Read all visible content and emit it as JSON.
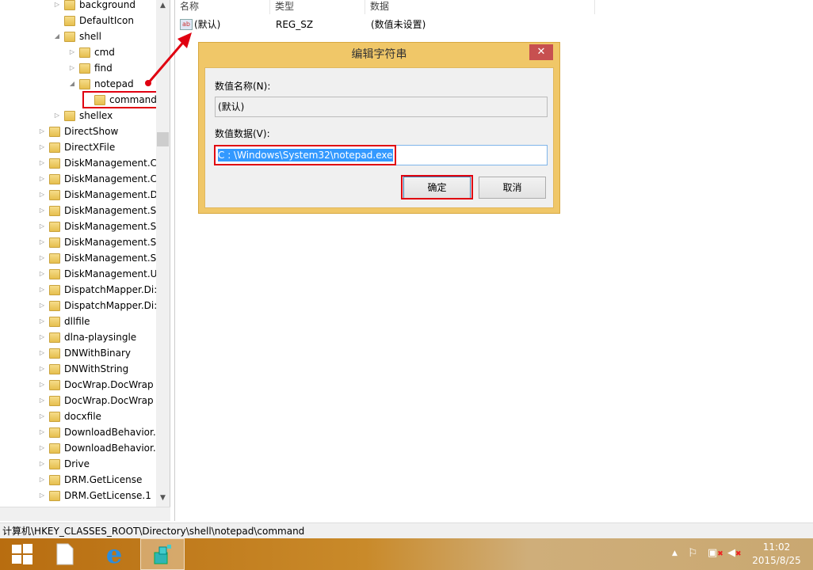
{
  "tree": {
    "items": [
      {
        "label": "background",
        "level": 2,
        "expander": "collapsed"
      },
      {
        "label": "DefaultIcon",
        "level": 2,
        "expander": "none"
      },
      {
        "label": "shell",
        "level": 2,
        "expander": "expanded"
      },
      {
        "label": "cmd",
        "level": 3,
        "expander": "collapsed"
      },
      {
        "label": "find",
        "level": 3,
        "expander": "collapsed"
      },
      {
        "label": "notepad",
        "level": 3,
        "expander": "expanded"
      },
      {
        "label": "command",
        "level": 4,
        "expander": "none",
        "selected": true
      },
      {
        "label": "shellex",
        "level": 2,
        "expander": "collapsed"
      },
      {
        "label": "DirectShow",
        "level": 1,
        "expander": "collapsed"
      },
      {
        "label": "DirectXFile",
        "level": 1,
        "expander": "collapsed"
      },
      {
        "label": "DiskManagement.C",
        "level": 1,
        "expander": "collapsed"
      },
      {
        "label": "DiskManagement.C",
        "level": 1,
        "expander": "collapsed"
      },
      {
        "label": "DiskManagement.D",
        "level": 1,
        "expander": "collapsed"
      },
      {
        "label": "DiskManagement.Sı",
        "level": 1,
        "expander": "collapsed"
      },
      {
        "label": "DiskManagement.Sı",
        "level": 1,
        "expander": "collapsed"
      },
      {
        "label": "DiskManagement.Sı",
        "level": 1,
        "expander": "collapsed"
      },
      {
        "label": "DiskManagement.Sı",
        "level": 1,
        "expander": "collapsed"
      },
      {
        "label": "DiskManagement.U",
        "level": 1,
        "expander": "collapsed"
      },
      {
        "label": "DispatchMapper.Di:",
        "level": 1,
        "expander": "collapsed"
      },
      {
        "label": "DispatchMapper.Di:",
        "level": 1,
        "expander": "collapsed"
      },
      {
        "label": "dllfile",
        "level": 1,
        "expander": "collapsed"
      },
      {
        "label": "dlna-playsingle",
        "level": 1,
        "expander": "collapsed"
      },
      {
        "label": "DNWithBinary",
        "level": 1,
        "expander": "collapsed"
      },
      {
        "label": "DNWithString",
        "level": 1,
        "expander": "collapsed"
      },
      {
        "label": "DocWrap.DocWrap",
        "level": 1,
        "expander": "collapsed"
      },
      {
        "label": "DocWrap.DocWrap",
        "level": 1,
        "expander": "collapsed"
      },
      {
        "label": "docxfile",
        "level": 1,
        "expander": "collapsed"
      },
      {
        "label": "DownloadBehavior.",
        "level": 1,
        "expander": "collapsed"
      },
      {
        "label": "DownloadBehavior.",
        "level": 1,
        "expander": "collapsed"
      },
      {
        "label": "Drive",
        "level": 1,
        "expander": "collapsed"
      },
      {
        "label": "DRM.GetLicense",
        "level": 1,
        "expander": "collapsed"
      },
      {
        "label": "DRM.GetLicense.1",
        "level": 1,
        "expander": "collapsed"
      }
    ]
  },
  "list": {
    "headers": [
      "名称",
      "类型",
      "数据"
    ],
    "rows": [
      {
        "name": "(默认)",
        "type": "REG_SZ",
        "data": "(数值未设置)",
        "icon": "string-value-icon"
      }
    ]
  },
  "dialog": {
    "title": "编辑字符串",
    "close": "✕",
    "name_label": "数值名称(N):",
    "name_value": "(默认)",
    "data_label": "数值数据(V):",
    "data_value": "C : \\Windows\\System32\\notepad.exe",
    "ok": "确定",
    "cancel": "取消"
  },
  "status": {
    "path": "计算机\\HKEY_CLASSES_ROOT\\Directory\\shell\\notepad\\command"
  },
  "taskbar": {
    "time": "11:02",
    "date": "2015/8/25"
  },
  "colors": {
    "accent": "#3399ff",
    "annotation": "#e00010",
    "dialog_frame": "#f0c768"
  }
}
